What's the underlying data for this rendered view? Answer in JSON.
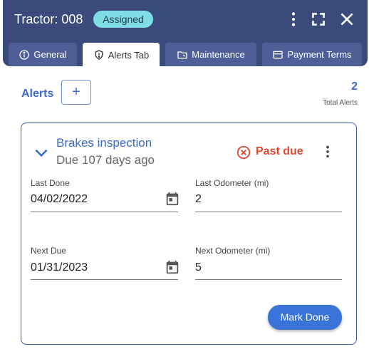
{
  "header": {
    "title": "Tractor: 008",
    "status_badge": "Assigned"
  },
  "tabs": [
    {
      "label": "General",
      "icon": "info-circle-icon",
      "active": false
    },
    {
      "label": "Alerts Tab",
      "icon": "shield-alert-icon",
      "active": true
    },
    {
      "label": "Maintenance",
      "icon": "folder-wrench-icon",
      "active": false
    },
    {
      "label": "Payment Terms",
      "icon": "credit-card-icon",
      "active": false
    }
  ],
  "alerts_section": {
    "title": "Alerts",
    "add_label": "+",
    "total_count": "2",
    "total_label": "Total Alerts"
  },
  "alert": {
    "name": "Brakes inspection",
    "due_text": "Due 107 days ago",
    "status": "Past due",
    "status_color": "#e04834",
    "last_done_label": "Last Done",
    "last_done_value": "04/02/2022",
    "last_odometer_label": "Last Odometer (mi)",
    "last_odometer_value": "2",
    "next_due_label": "Next Due",
    "next_due_value": "01/31/2023",
    "next_odometer_label": "Next Odometer (mi)",
    "next_odometer_value": "5",
    "mark_done_label": "Mark Done"
  },
  "colors": {
    "header_bg": "#3a4a7a",
    "accent": "#3c6ac6",
    "badge_bg": "#7fdde6"
  }
}
